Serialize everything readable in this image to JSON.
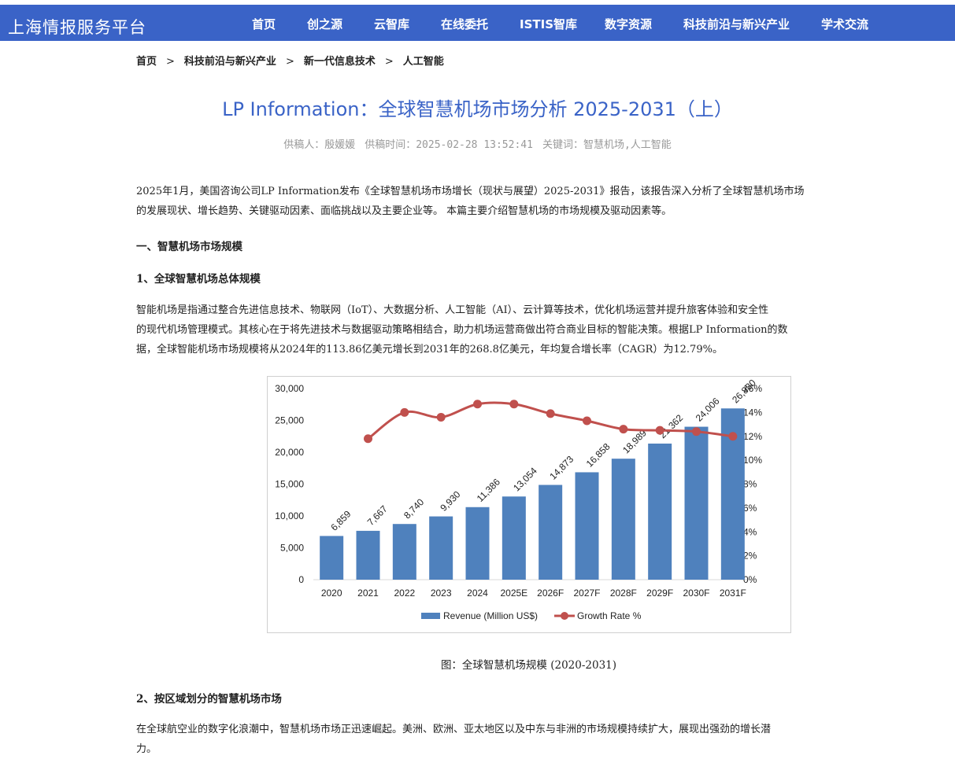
{
  "site": {
    "logo": "上海情报服务平台"
  },
  "nav": {
    "items": [
      "首页",
      "创之源",
      "云智库",
      "在线委托",
      "ISTIS智库",
      "数字资源",
      "科技前沿与新兴产业",
      "学术交流"
    ]
  },
  "breadcrumb": {
    "items": [
      "首页",
      "科技前沿与新兴产业",
      "新一代信息技术",
      "人工智能"
    ],
    "separator": ">"
  },
  "article": {
    "title": "LP Information：全球智慧机场市场分析 2025-2031（上）",
    "meta": {
      "author": "供稿人：殷媛媛",
      "time": "供稿时间：2025-02-28 13:52:41",
      "keywords": "关键词：智慧机场,人工智能"
    },
    "intro_line1": "2025年1月，美国咨询公司LP Information发布《全球智慧机场市场增长（现状与展望）2025-2031》报告，该报告深入分析了全球智慧机场市场",
    "intro_line2": "的发展现状、增长趋势、关键驱动因素、面临挑战以及主要企业等。 本篇主要介绍智慧机场的市场规模及驱动因素等。",
    "section1": "一、智慧机场市场规模",
    "sub1": "1、全球智慧机场总体规模",
    "body1_line1": "智能机场是指通过整合先进信息技术、物联网（IoT）、大数据分析、人工智能（AI）、云计算等技术，优化机场运营并提升旅客体验和安全性",
    "body1_line2": "的现代机场管理模式。其核心在于将先进技术与数据驱动策略相结合，助力机场运营商做出符合商业目标的智能决策。根据LP Information的数",
    "body1_line3": "据，全球智能机场市场规模将从2024年的113.86亿美元增长到2031年的268.8亿美元，年均复合增长率（CAGR）为12.79%。",
    "caption": "图：全球智慧机场规模 (2020-2031)",
    "sub2": "2、按区域划分的智慧机场市场",
    "body2_line1": "在全球航空业的数字化浪潮中，智慧机场市场正迅速崛起。美洲、欧洲、亚太地区以及中东与非洲的市场规模持续扩大，展现出强劲的增长潜",
    "body2_line2": "力。"
  },
  "chart_data": {
    "type": "bar",
    "categories": [
      "2020",
      "2021",
      "2022",
      "2023",
      "2024",
      "2025E",
      "2026F",
      "2027F",
      "2028F",
      "2029F",
      "2030F",
      "2031F"
    ],
    "series": [
      {
        "name": "Revenue (Million US$)",
        "type": "bar",
        "axis": "left",
        "color": "#4f81bd",
        "values": [
          6859,
          7667,
          8740,
          9930,
          11386,
          13054,
          14873,
          16858,
          18989,
          21362,
          24006,
          26880
        ],
        "labels": [
          "6,859",
          "7,667",
          "8,740",
          "9,930",
          "11,386",
          "13,054",
          "14,873",
          "16,858",
          "18,989",
          "21,362",
          "24,006",
          "26,880"
        ]
      },
      {
        "name": "Growth Rate %",
        "type": "line",
        "axis": "right",
        "color": "#c0504d",
        "values": [
          null,
          11.8,
          14.0,
          13.6,
          14.7,
          14.7,
          13.9,
          13.3,
          12.6,
          12.5,
          12.4,
          12.0
        ]
      }
    ],
    "ylim_left": [
      0,
      30000
    ],
    "yticks_left": [
      "0",
      "5,000",
      "10,000",
      "15,000",
      "20,000",
      "25,000",
      "30,000"
    ],
    "ylim_right": [
      0,
      16
    ],
    "yticks_right": [
      "0%",
      "2%",
      "4%",
      "6%",
      "8%",
      "10%",
      "12%",
      "14%",
      "16%"
    ],
    "legend_position": "bottom",
    "grid": false
  }
}
